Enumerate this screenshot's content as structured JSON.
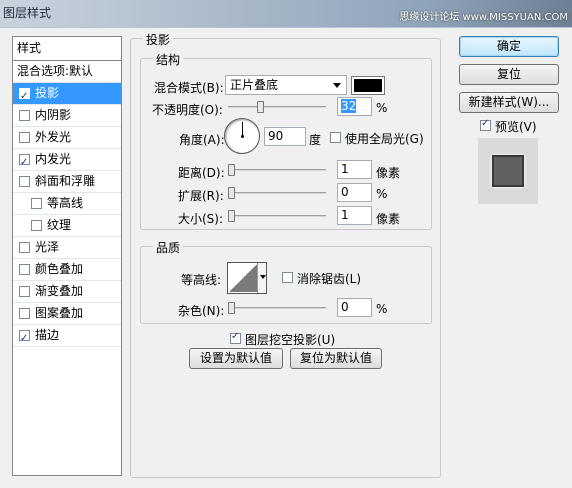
{
  "window": {
    "title": "图层样式",
    "watermark": "思缘设计论坛 www.MISSYUAN.COM"
  },
  "sidebar": {
    "header": "样式",
    "items": [
      {
        "label": "混合选项:默认",
        "checkbox": false,
        "checked": false,
        "selected": false,
        "sub": false
      },
      {
        "label": "投影",
        "checkbox": true,
        "checked": true,
        "selected": true,
        "sub": false
      },
      {
        "label": "内阴影",
        "checkbox": true,
        "checked": false,
        "selected": false,
        "sub": false
      },
      {
        "label": "外发光",
        "checkbox": true,
        "checked": false,
        "selected": false,
        "sub": false
      },
      {
        "label": "内发光",
        "checkbox": true,
        "checked": true,
        "selected": false,
        "sub": false
      },
      {
        "label": "斜面和浮雕",
        "checkbox": true,
        "checked": false,
        "selected": false,
        "sub": false
      },
      {
        "label": "等高线",
        "checkbox": true,
        "checked": false,
        "selected": false,
        "sub": true
      },
      {
        "label": "纹理",
        "checkbox": true,
        "checked": false,
        "selected": false,
        "sub": true
      },
      {
        "label": "光泽",
        "checkbox": true,
        "checked": false,
        "selected": false,
        "sub": false
      },
      {
        "label": "颜色叠加",
        "checkbox": true,
        "checked": false,
        "selected": false,
        "sub": false
      },
      {
        "label": "渐变叠加",
        "checkbox": true,
        "checked": false,
        "selected": false,
        "sub": false
      },
      {
        "label": "图案叠加",
        "checkbox": true,
        "checked": false,
        "selected": false,
        "sub": false
      },
      {
        "label": "描边",
        "checkbox": true,
        "checked": true,
        "selected": false,
        "sub": false
      }
    ]
  },
  "panel": {
    "section_title": "投影",
    "structure": {
      "title": "结构",
      "blend_mode_label": "混合模式(B):",
      "blend_mode_value": "正片叠底",
      "shadow_color": "#000000",
      "opacity_label": "不透明度(O):",
      "opacity_value": "32",
      "opacity_fraction": 0.32,
      "percent": "%",
      "angle_label": "角度(A):",
      "angle_value": "90",
      "angle_unit": "度",
      "global_light_label": "使用全局光(G)",
      "global_light_checked": false,
      "distance_label": "距离(D):",
      "distance_value": "1",
      "distance_unit": "像素",
      "spread_label": "扩展(R):",
      "spread_value": "0",
      "spread_unit": "%",
      "size_label": "大小(S):",
      "size_value": "1",
      "size_unit": "像素"
    },
    "quality": {
      "title": "品质",
      "contour_label": "等高线:",
      "antialias_label": "消除锯齿(L)",
      "antialias_checked": false,
      "noise_label": "杂色(N):",
      "noise_value": "0",
      "noise_unit": "%"
    },
    "knockout_label": "图层挖空投影(U)",
    "knockout_checked": true,
    "make_default_label": "设置为默认值",
    "reset_default_label": "复位为默认值"
  },
  "actions": {
    "ok_label": "确定",
    "reset_label": "复位",
    "new_style_label": "新建样式(W)...",
    "preview_label": "预览(V)",
    "preview_checked": true
  }
}
